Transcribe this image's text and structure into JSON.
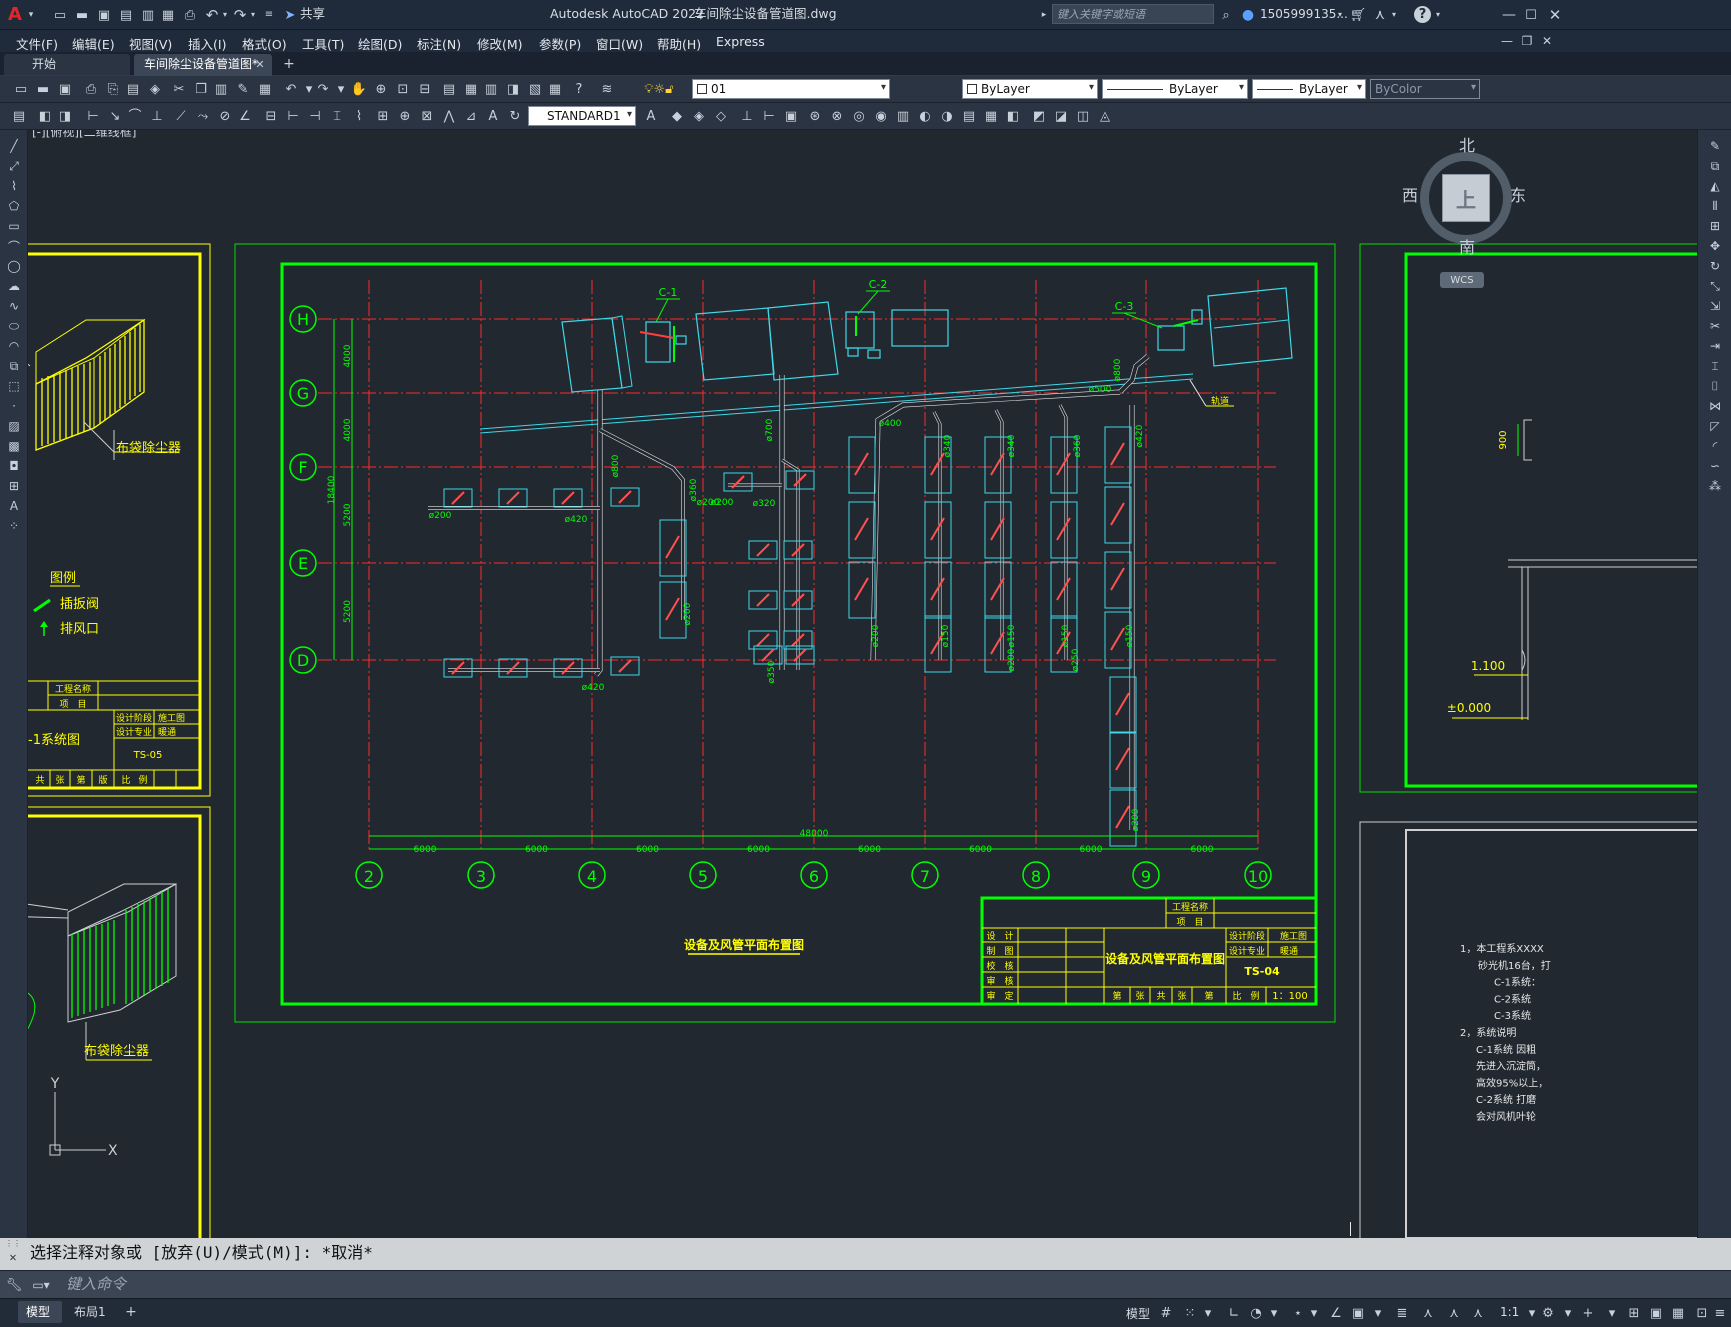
{
  "app": {
    "title": "Autodesk AutoCAD 2022",
    "filename": "车间除尘设备管道图.dwg",
    "share_label": "共享",
    "search_placeholder": "键入关键字或短语",
    "user": "1505999135...",
    "window_controls": [
      "minimize-icon",
      "maximize-icon",
      "close-icon"
    ]
  },
  "menu": [
    "文件(F)",
    "编辑(E)",
    "视图(V)",
    "插入(I)",
    "格式(O)",
    "工具(T)",
    "绘图(D)",
    "标注(N)",
    "修改(M)",
    "参数(P)",
    "窗口(W)",
    "帮助(H)",
    "Express"
  ],
  "tabs": [
    {
      "label": "开始",
      "active": false
    },
    {
      "label": "车间除尘设备管道图*",
      "active": true
    }
  ],
  "toolbar": {
    "layer_value": "01",
    "color_value": "ByLayer",
    "linetype_value": "ByLayer",
    "lineweight_value": "ByLayer",
    "plotstyle_value": "ByColor",
    "textstyle_value": "STANDARD1"
  },
  "viewport": {
    "label": "[-][俯视][二维线框]",
    "viewcube": {
      "north": "北",
      "south": "南",
      "east": "东",
      "west": "西",
      "top": "上",
      "wcs": "WCS"
    }
  },
  "drawing": {
    "row_labels": [
      "H",
      "G",
      "F",
      "E",
      "D"
    ],
    "col_labels": [
      "2",
      "3",
      "4",
      "5",
      "6",
      "7",
      "8",
      "9",
      "10"
    ],
    "span_labels": [
      "6000",
      "6000",
      "6000",
      "6000",
      "6000",
      "6000",
      "6000",
      "6000"
    ],
    "total_span": "48000",
    "vertical_dims": [
      "4000",
      "4000",
      "5200",
      "5200"
    ],
    "total_vertical": "18400",
    "equipment_labels": [
      "C-1",
      "C-2",
      "C-3"
    ],
    "pipe_labels": [
      "ø200",
      "ø420",
      "ø800",
      "ø360",
      "ø200",
      "ø700",
      "ø320",
      "ø200",
      "ø400",
      "ø340",
      "ø340",
      "ø360",
      "ø420",
      "ø500",
      "ø800",
      "ø150",
      "ø150",
      "ø150",
      "ø150",
      "ø200",
      "ø200",
      "ø200",
      "ø250",
      "ø200",
      "ø420",
      "ø350"
    ],
    "track_label": "轨道",
    "plan_title": "设备及风管平面布置图",
    "title_block": {
      "project_name": "工程名称",
      "item": "项　目",
      "roles": [
        "设　计",
        "制　图",
        "校　核",
        "审　核",
        "审　定"
      ],
      "drawing_name": "设备及风管平面布置图",
      "stage_label": "设计阶段",
      "stage_value": "施工图",
      "major_label": "设计专业",
      "major_value": "暖通",
      "drawing_no": "TS-04",
      "scale_label": "比　例",
      "scale_value": "1：100",
      "bottom_cells": [
        "第",
        "张",
        "共",
        "张",
        "第",
        "版"
      ]
    },
    "left_sheet": {
      "collector_label": "布袋除尘器",
      "legend_title": "图例",
      "legend_items": [
        "插扳阀",
        "排风口"
      ],
      "title_block_project": "工程名称",
      "title_block_item": "项　目",
      "stage_label": "设计阶段",
      "stage_value": "施工图",
      "major_label": "设计专业",
      "major_value": "暖通",
      "drawing_name": "-1系统图",
      "drawing_no": "TS-05",
      "bottom_cells": [
        "共",
        "张",
        "第",
        "版",
        "比",
        "例"
      ]
    },
    "left_sheet_2": {
      "collector_label": "布袋除尘器",
      "axis_y": "Y",
      "axis_x": "X"
    },
    "right_sheet": {
      "dim_900": "900",
      "elev_1": "1.100",
      "elev_2": "±0.000",
      "notes": [
        "1，本工程系XXXX",
        "砂光机16台，打",
        "C-1系统：",
        "C-2系统",
        "C-3系统",
        "2，系统说明",
        "C-1系统 因粗",
        "先进入沉淀筒，",
        "高效95%以上，",
        "C-2系统 打磨",
        "会对风机叶轮"
      ]
    }
  },
  "command": {
    "history": "选择注释对象或 [放弃(U)/模式(M)]: *取消*",
    "placeholder": "键入命令"
  },
  "status": {
    "layout_tabs": [
      "模型",
      "布局1"
    ],
    "model_label": "模型",
    "scale": "1:1"
  },
  "colors": {
    "frame_green": "#00ff00",
    "grid_red": "#ff2020",
    "duct_white": "#e8e8e8",
    "equipment_cyan": "#40d8e8",
    "text_yellow": "#ffff00"
  }
}
